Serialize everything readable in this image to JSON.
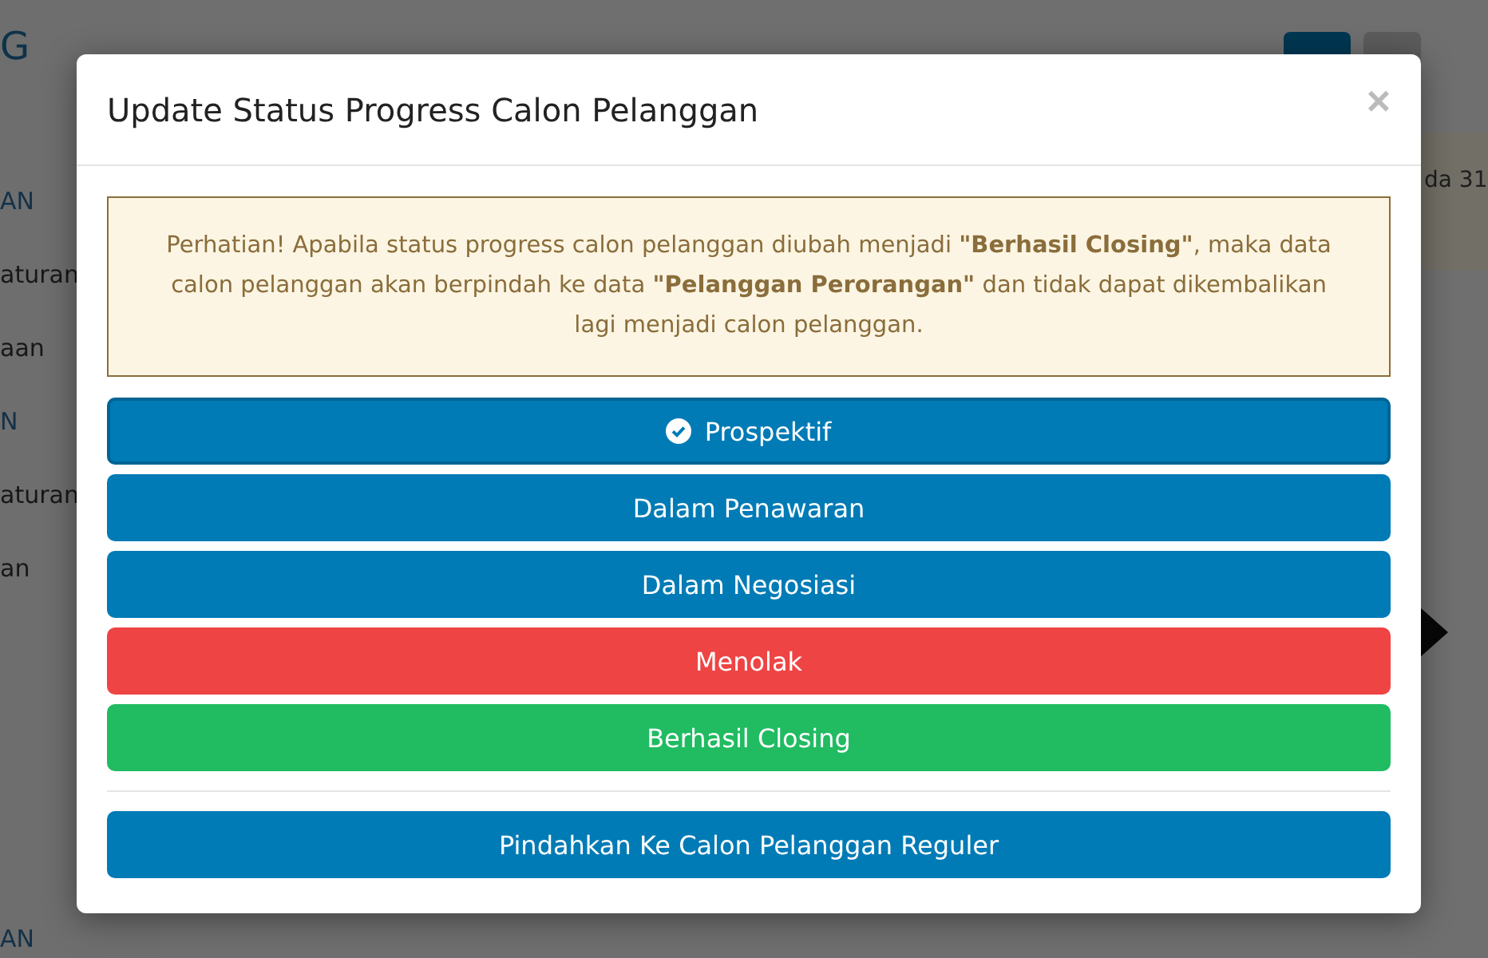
{
  "sidebar": {
    "logo_fragment": "G",
    "items": [
      {
        "label": "AN",
        "kind": "heading"
      },
      {
        "label": "aturan",
        "kind": "link"
      },
      {
        "label": "aan",
        "kind": "link"
      },
      {
        "label": "N",
        "kind": "heading"
      },
      {
        "label": "aturan",
        "kind": "link"
      },
      {
        "label": "an",
        "kind": "link"
      }
    ],
    "bottom_heading": "AN"
  },
  "info_box": {
    "text": "da 31"
  },
  "modal": {
    "title": "Update Status Progress Calon Pelanggan",
    "close": "×",
    "alert": "Perhatian! Apabila status progress calon pelanggan diubah menjadi **\"Berhasil Closing\"**, maka data calon pelanggan akan berpindah ke data **\"Pelanggan Perorangan\"** dan tidak dapat dikembalikan lagi menjadi calon pelanggan.",
    "status_buttons": [
      {
        "label": "Prospektif",
        "kind": "primary",
        "selected": true
      },
      {
        "label": "Dalam Penawaran",
        "kind": "primary",
        "selected": false
      },
      {
        "label": "Dalam Negosiasi",
        "kind": "primary",
        "selected": false
      },
      {
        "label": "Menolak",
        "kind": "danger",
        "selected": false
      },
      {
        "label": "Berhasil Closing",
        "kind": "success",
        "selected": false
      }
    ],
    "footer_button": {
      "label": "Pindahkan Ke Calon Pelanggan Reguler",
      "kind": "primary"
    }
  }
}
